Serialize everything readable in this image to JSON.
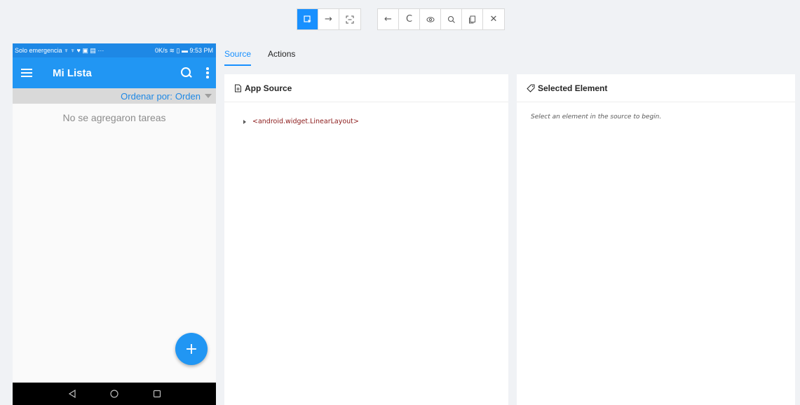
{
  "toolbar": {
    "group1": [
      {
        "name": "select-element-icon",
        "glyph": "⇱",
        "active": true
      },
      {
        "name": "swipe-icon",
        "glyph": "→",
        "active": false
      },
      {
        "name": "tap-by-coordinates-icon",
        "glyph": "⛶",
        "active": false
      }
    ],
    "group2": [
      {
        "name": "back-icon",
        "glyph": "←"
      },
      {
        "name": "refresh-icon",
        "glyph": "C"
      },
      {
        "name": "eye-icon",
        "glyph": "◎"
      },
      {
        "name": "search-icon",
        "glyph": "⚲"
      },
      {
        "name": "copy-icon",
        "glyph": "❐"
      },
      {
        "name": "close-icon",
        "glyph": "✕"
      }
    ]
  },
  "device": {
    "status_left": "Solo emergencia ♆ ♆ ♥ ▣ ▤ ···",
    "status_right": "0K/s ≋ ▯ ▬ 9:53 PM",
    "app_title": "Mi Lista",
    "sort_label": "Ordenar por:",
    "sort_value": "Orden",
    "empty_message": "No se agregaron tareas",
    "fab_label": "+"
  },
  "tabs": [
    {
      "label": "Source",
      "active": true
    },
    {
      "label": "Actions",
      "active": false
    }
  ],
  "source_panel": {
    "title": "App Source",
    "node": "<android.widget.LinearLayout>"
  },
  "selected_panel": {
    "title": "Selected Element",
    "hint": "Select an element in the source to begin."
  },
  "colors": {
    "accent": "#1890ff",
    "app_bar": "#2196f3",
    "status_bar": "#1e88e5"
  }
}
